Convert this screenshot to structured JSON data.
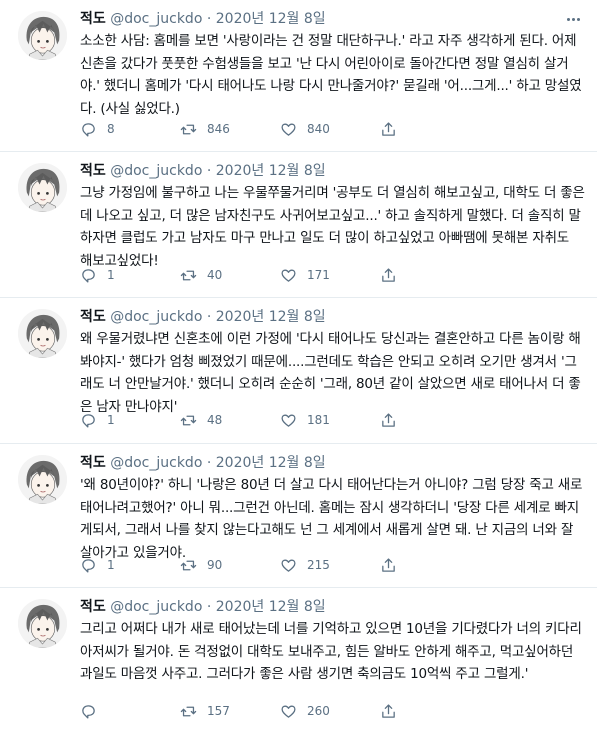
{
  "author": {
    "name": "적도",
    "handle": "@doc_juckdo",
    "date": "2020년 12월 8일",
    "separator": "·"
  },
  "icons": {
    "reply": "reply-icon",
    "retweet": "retweet-icon",
    "like": "like-icon",
    "share": "share-icon",
    "more": "more-icon"
  },
  "colors": {
    "meta": "#5b7083",
    "border": "#e6ecf0",
    "text": "#0f1419"
  },
  "tweets": [
    {
      "text": "소소한 사담: 홈메를 보면 '사랑이라는 건 정말 대단하구나.' 라고 자주 생각하게 된다. 어제 신촌을 갔다가 풋풋한 수험생들을 보고 '난 다시 어린아이로 돌아간다면 정말 열심히 살거야.' 했더니 홈메가 '다시 태어나도 나랑 다시 만나줄거야?' 묻길래 '어...그게...' 하고 망설였다. (사실 싫었다.)",
      "replies": "8",
      "retweets": "846",
      "likes": "840"
    },
    {
      "text": "그냥 가정임에 불구하고 나는 우물쭈물거리며 '공부도 더 열심히 해보고싶고, 대학도 더 좋은데 나오고 싶고, 더 많은 남자친구도 사귀어보고싶고...' 하고 솔직하게 말했다. 더 솔직히 말하자면 클럽도 가고 남자도 마구 만나고 일도 더 많이 하고싶었고 아빠땜에 못해본 자취도 해보고싶었다!",
      "replies": "1",
      "retweets": "40",
      "likes": "171"
    },
    {
      "text": "왜 우물거렸냐면 신혼초에 이런 가정에 '다시 태어나도 당신과는 결혼안하고 다른 놈이랑 해봐야지-' 했다가 엄청 삐졌었기 때문에....그런데도 학습은 안되고 오히려 오기만 생겨서 '그래도 너 안만날거야.' 했더니 오히려 순순히 '그래, 80년 같이 살았으면 새로 태어나서 더 좋은 남자 만나야지'",
      "replies": "1",
      "retweets": "48",
      "likes": "181"
    },
    {
      "text": "'왜 80년이야?' 하니 '나랑은 80년 더 살고 다시 태어난다는거 아니야? 그럼 당장 죽고 새로 태어나려고했어?' 아니 뭐...그런건 아닌데. 홈메는 잠시 생각하더니 '당장 다른 세계로 빠지게되서, 그래서 나를 찾지 않는다고해도 넌 그 세계에서 새롭게 살면 돼. 난 지금의 너와 잘 살아가고 있을거야.",
      "replies": "1",
      "retweets": "90",
      "likes": "215"
    },
    {
      "text": "그리고 어쩌다 내가 새로 태어났는데 너를 기억하고 있으면 10년을 기다렸다가 너의 키다리 아저씨가 될거야. 돈 걱정없이 대학도 보내주고, 힘든 알바도 안하게 해주고, 먹고싶어하던 과일도 마음껏 사주고. 그러다가 좋은 사람 생기면 축의금도 10억씩 주고 그럴게.'",
      "replies": "",
      "retweets": "157",
      "likes": "260"
    }
  ]
}
